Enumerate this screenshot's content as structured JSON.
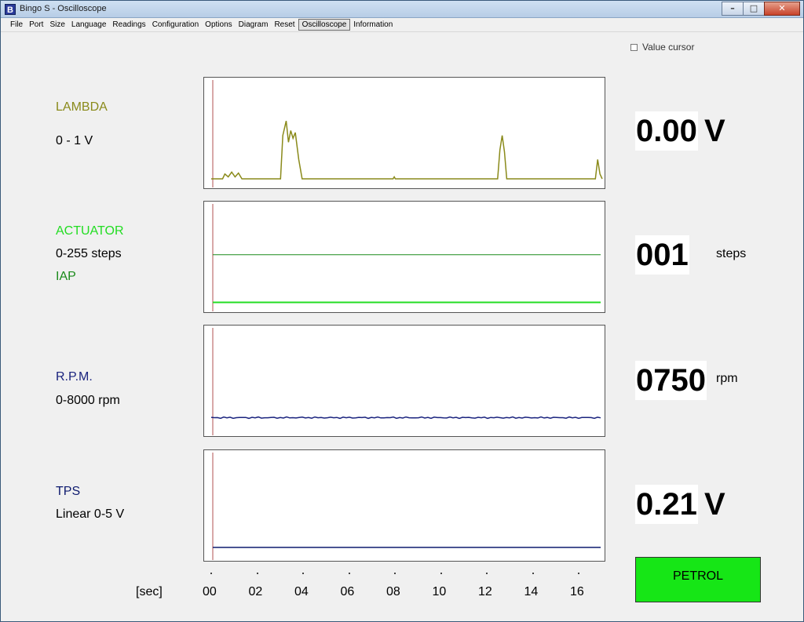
{
  "window": {
    "title": "Bingo S - Oscilloscope",
    "icon_letter": "B"
  },
  "menu": [
    "File",
    "Port",
    "Size",
    "Language",
    "Readings",
    "Configuration",
    "Options",
    "Diagram",
    "Reset",
    "Oscilloscope",
    "Information"
  ],
  "menu_active": "Oscilloscope",
  "value_cursor_label": "Value cursor",
  "channels": {
    "lambda": {
      "name": "LAMBDA",
      "range": "0 - 1 V",
      "value": "0.00",
      "unit": "V",
      "color": "#8a8a1a"
    },
    "actuator": {
      "name": "ACTUATOR",
      "range": "0-255 steps",
      "secondary": "IAP",
      "value": "001",
      "unit": "steps",
      "color": "#22dd22",
      "secondary_color": "#1a8a1a"
    },
    "rpm": {
      "name": "R.P.M.",
      "range": "0-8000 rpm",
      "value": "0750",
      "unit": "rpm",
      "color": "#1a237e"
    },
    "tps": {
      "name": "TPS",
      "range": "Linear 0-5 V",
      "value": "0.21",
      "unit": "V",
      "color": "#0d1a6e"
    }
  },
  "status_button": "PETROL",
  "xaxis": {
    "label": "[sec]",
    "ticks": [
      "00",
      "02",
      "04",
      "06",
      "08",
      "10",
      "12",
      "14",
      "16"
    ]
  },
  "chart_data": [
    {
      "type": "line",
      "series": [
        {
          "name": "LAMBDA",
          "x": [
            0.0,
            0.5,
            0.6,
            0.75,
            0.9,
            1.05,
            1.2,
            1.35,
            3.05,
            3.15,
            3.3,
            3.4,
            3.5,
            3.6,
            3.7,
            3.85,
            4.0,
            8.0,
            8.05,
            8.1,
            12.6,
            12.7,
            12.8,
            12.9,
            13.0,
            16.9,
            17.0,
            17.1,
            17.2
          ],
          "y": [
            0.0,
            0.0,
            0.05,
            0.02,
            0.07,
            0.02,
            0.06,
            0.0,
            0.0,
            0.45,
            0.6,
            0.38,
            0.5,
            0.42,
            0.48,
            0.2,
            0.0,
            0.0,
            0.02,
            0.0,
            0.0,
            0.3,
            0.45,
            0.28,
            0.0,
            0.0,
            0.2,
            0.05,
            0.0
          ]
        }
      ],
      "ylim": [
        0,
        1
      ],
      "xlim": [
        0,
        17.2
      ]
    },
    {
      "type": "line",
      "series": [
        {
          "name": "ACTUATOR",
          "x": [
            0,
            17.2
          ],
          "y": [
            1,
            1
          ]
        },
        {
          "name": "IAP",
          "x": [
            0,
            17.2
          ],
          "y": [
            127,
            127
          ]
        }
      ],
      "ylim": [
        0,
        255
      ],
      "xlim": [
        0,
        17.2
      ]
    },
    {
      "type": "line",
      "series": [
        {
          "name": "R.P.M.",
          "x": [
            0,
            17.2
          ],
          "y": [
            750,
            750
          ]
        }
      ],
      "ylim": [
        0,
        8000
      ],
      "xlim": [
        0,
        17.2
      ]
    },
    {
      "type": "line",
      "series": [
        {
          "name": "TPS",
          "x": [
            0,
            17.2
          ],
          "y": [
            0.21,
            0.21
          ]
        }
      ],
      "ylim": [
        0,
        5
      ],
      "xlim": [
        0,
        17.2
      ]
    }
  ]
}
